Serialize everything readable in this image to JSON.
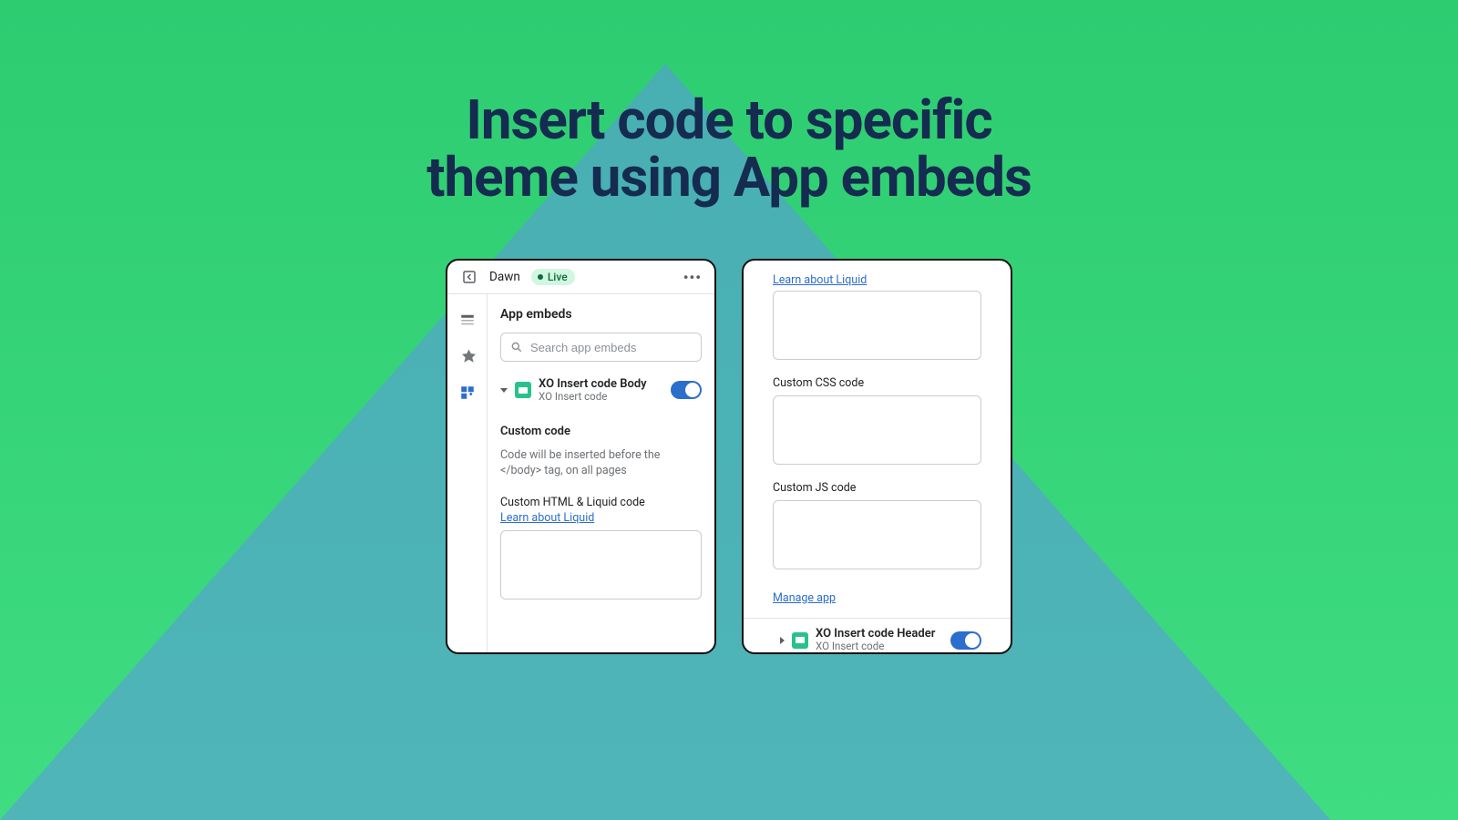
{
  "headline": {
    "line1": "Insert code to specific",
    "line2": "theme using App embeds"
  },
  "card1": {
    "theme_name": "Dawn",
    "live_label": "Live",
    "panel_title": "App embeds",
    "search_placeholder": "Search app embeds",
    "embed": {
      "title": "XO Insert code Body",
      "subtitle": "XO Insert code"
    },
    "section_label": "Custom code",
    "help_text": "Code will be inserted before the </body> tag, on all pages",
    "field_label": "Custom HTML & Liquid code",
    "learn_link": "Learn about Liquid"
  },
  "card2": {
    "top_learn_link": "Learn about Liquid",
    "css_label": "Custom CSS code",
    "js_label": "Custom JS code",
    "manage_link": "Manage app",
    "embed": {
      "title": "XO Insert code Header",
      "subtitle": "XO Insert code"
    }
  }
}
